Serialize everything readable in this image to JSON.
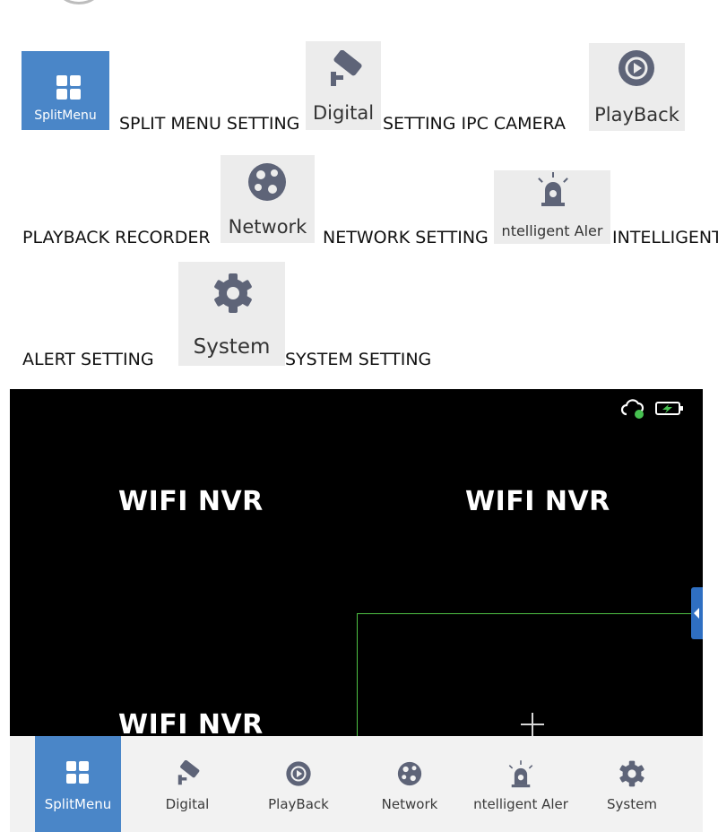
{
  "legend": {
    "splitmenu": {
      "icon_label": "SplitMenu",
      "desc": "SPLIT MENU SETTING"
    },
    "digital": {
      "icon_label": "Digital",
      "desc": "SETTING IPC CAMERA"
    },
    "playback": {
      "icon_label": "PlayBack",
      "desc": "PLAYBACK RECORDER"
    },
    "network": {
      "icon_label": "Network",
      "desc": "NETWORK SETTING"
    },
    "alert": {
      "icon_label": "ntelligent Aler",
      "desc": "INTELLIGENT",
      "desc_cont": "ALERT SETTING"
    },
    "system": {
      "icon_label": "System",
      "desc": "SYSTEM SETTING"
    }
  },
  "screen": {
    "channels": [
      "WIFI NVR",
      "WIFI NVR",
      "WIFI NVR"
    ],
    "status_icons": [
      "cloud-connected-icon",
      "battery-charging-icon"
    ]
  },
  "taskbar": {
    "items": [
      {
        "label": "SplitMenu",
        "icon": "grid-icon",
        "active": true
      },
      {
        "label": "Digital",
        "icon": "camera-icon",
        "active": false
      },
      {
        "label": "PlayBack",
        "icon": "playback-icon",
        "active": false
      },
      {
        "label": "Network",
        "icon": "network-globe-icon",
        "active": false
      },
      {
        "label": "ntelligent Aler",
        "icon": "alarm-siren-icon",
        "active": false
      },
      {
        "label": "System",
        "icon": "gear-icon",
        "active": false
      }
    ]
  },
  "colors": {
    "accent": "#4a86c8",
    "tile_bg": "#ececec",
    "icon_gray": "#5e6478",
    "selection": "#4fc244"
  }
}
